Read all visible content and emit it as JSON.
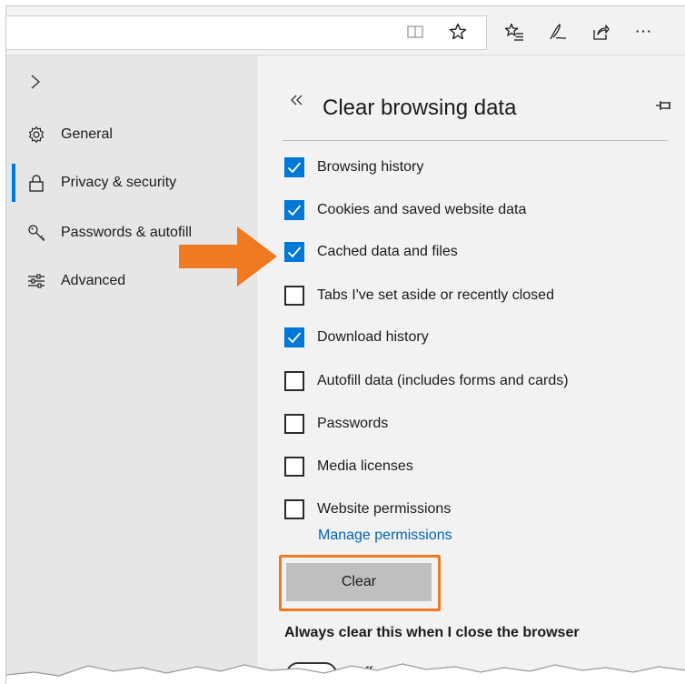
{
  "toolbar": {
    "icons": [
      "reading-view-icon",
      "favorite-star-icon",
      "favorites-list-icon",
      "pen-icon",
      "share-icon",
      "more-icon"
    ],
    "more_label": "···"
  },
  "sidebar": {
    "expand_icon": "chevron-right-icon",
    "items": [
      {
        "label": "General",
        "icon": "gear-icon",
        "active": false
      },
      {
        "label": "Privacy & security",
        "icon": "lock-icon",
        "active": true
      },
      {
        "label": "Passwords & autofill",
        "icon": "key-icon",
        "active": false
      },
      {
        "label": "Advanced",
        "icon": "sliders-icon",
        "active": false
      }
    ],
    "accent_color": "#0078d7"
  },
  "panel": {
    "back_icon": "double-chevron-left-icon",
    "title": "Clear browsing data",
    "pin_icon": "pin-icon",
    "options": [
      {
        "label": "Browsing history",
        "checked": true
      },
      {
        "label": "Cookies and saved website data",
        "checked": true
      },
      {
        "label": "Cached data and files",
        "checked": true
      },
      {
        "label": "Tabs I've set aside or recently closed",
        "checked": false
      },
      {
        "label": "Download history",
        "checked": true
      },
      {
        "label": "Autofill data (includes forms and cards)",
        "checked": false
      },
      {
        "label": "Passwords",
        "checked": false
      },
      {
        "label": "Media licenses",
        "checked": false
      },
      {
        "label": "Website permissions",
        "checked": false
      }
    ],
    "manage_link": "Manage permissions",
    "clear_button": "Clear",
    "always_clear_label": "Always clear this when I close the browser",
    "toggle_state": "Off"
  },
  "annotations": {
    "arrow_color": "#f07a22",
    "highlight_color": "#f07a22"
  }
}
